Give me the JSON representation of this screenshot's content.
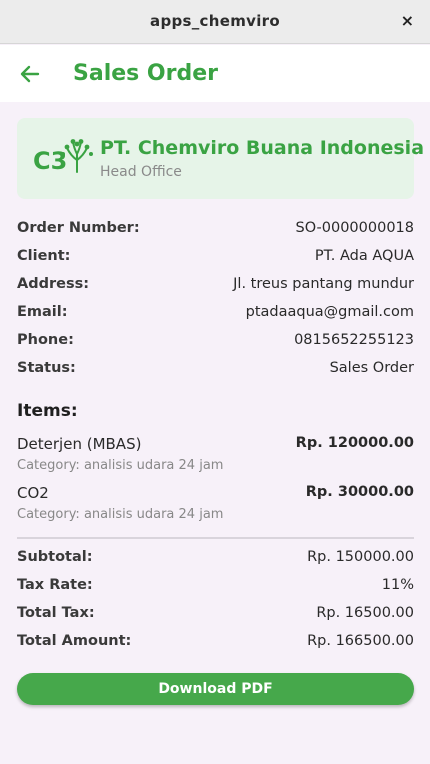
{
  "window": {
    "title": "apps_chemviro",
    "close_icon": "×"
  },
  "appbar": {
    "title": "Sales Order"
  },
  "company": {
    "name": "PT. Chemviro Buana Indonesia",
    "office": "Head Office",
    "logo_text": "C3",
    "accent": "#3aa343"
  },
  "order": {
    "fields": [
      {
        "label": "Order Number:",
        "value": "SO-0000000018"
      },
      {
        "label": "Client:",
        "value": "PT. Ada AQUA"
      },
      {
        "label": "Address:",
        "value": "Jl. treus pantang mundur"
      },
      {
        "label": "Email:",
        "value": "ptadaaqua@gmail.com"
      },
      {
        "label": "Phone:",
        "value": "0815652255123"
      },
      {
        "label": "Status:",
        "value": "Sales Order"
      }
    ]
  },
  "items": {
    "title": "Items:",
    "list": [
      {
        "name": "Deterjen (MBAS)",
        "price": "Rp. 120000.00",
        "category": "Category: analisis udara 24 jam"
      },
      {
        "name": "CO2",
        "price": "Rp. 30000.00",
        "category": "Category: analisis udara 24 jam"
      }
    ]
  },
  "totals": [
    {
      "label": "Subtotal:",
      "value": "Rp. 150000.00"
    },
    {
      "label": "Tax Rate:",
      "value": "11%"
    },
    {
      "label": "Total Tax:",
      "value": "Rp. 16500.00"
    },
    {
      "label": "Total Amount:",
      "value": "Rp. 166500.00"
    }
  ],
  "actions": {
    "download_label": "Download PDF"
  }
}
